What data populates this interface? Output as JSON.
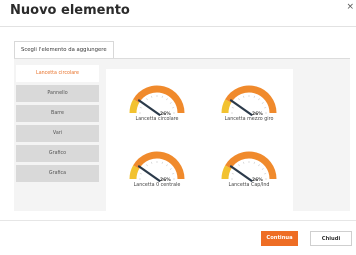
{
  "dialog": {
    "title": "Nuovo elemento",
    "close_label": "×"
  },
  "tab": {
    "label": "Scegli l'elemento da aggiungere"
  },
  "sidebar": {
    "items": [
      {
        "label": "Lancetta circolare",
        "active": true
      },
      {
        "label": "Pannello"
      },
      {
        "label": "Barre"
      },
      {
        "label": "Vari"
      },
      {
        "label": "Grafico"
      },
      {
        "label": "Grafica"
      }
    ]
  },
  "gauges": [
    {
      "label": "Lancetta circolare",
      "percent_text": "26%",
      "value": 0.26
    },
    {
      "label": "Lancetta mezzo giro",
      "percent_text": "26%",
      "value": 0.26
    },
    {
      "label": "Lancetta 0 centrale",
      "percent_text": "26%",
      "value": 0.26
    },
    {
      "label": "Lancetta Cap/Ind",
      "percent_text": "26%",
      "value": 0.26
    }
  ],
  "buttons": {
    "continue_label": "Continua",
    "close_label": "Chiudi"
  },
  "colors": {
    "accent": "#ee6d24",
    "gauge_orange": "#f08a2c",
    "gauge_yellow": "#f2c230",
    "needle": "#2b3a4a"
  }
}
